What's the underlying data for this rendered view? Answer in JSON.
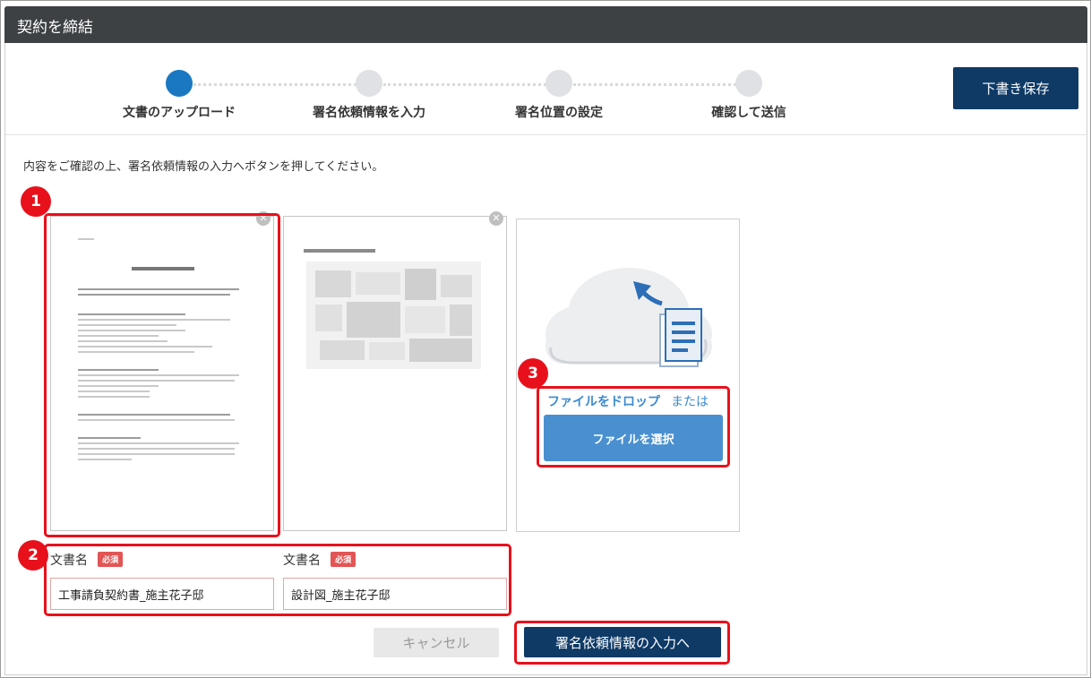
{
  "window": {
    "title": "契約を締結"
  },
  "stepper": {
    "steps": [
      {
        "label": "文書のアップロード",
        "active": true
      },
      {
        "label": "署名依頼情報を入力",
        "active": false
      },
      {
        "label": "署名位置の設定",
        "active": false
      },
      {
        "label": "確認して送信",
        "active": false
      }
    ],
    "draft_button": "下書き保存"
  },
  "instruction": "内容をご確認の上、署名依頼情報の入力へボタンを押してください。",
  "documents": [
    {
      "label": "文書名",
      "required": "必須",
      "value": "工事請負契約書_施主花子邸"
    },
    {
      "label": "文書名",
      "required": "必須",
      "value": "設計図_施主花子邸"
    }
  ],
  "upload": {
    "drop_text": "ファイルをドロップ",
    "or_text": "または",
    "select_button": "ファイルを選択"
  },
  "actions": {
    "cancel": "キャンセル",
    "submit": "署名依頼情報の入力へ"
  },
  "callouts": [
    "1",
    "2",
    "3"
  ],
  "colors": {
    "primary": "#0f3a66",
    "step_active": "#1a78c2",
    "callout": "#e8111b",
    "select_button": "#4a90d0"
  }
}
